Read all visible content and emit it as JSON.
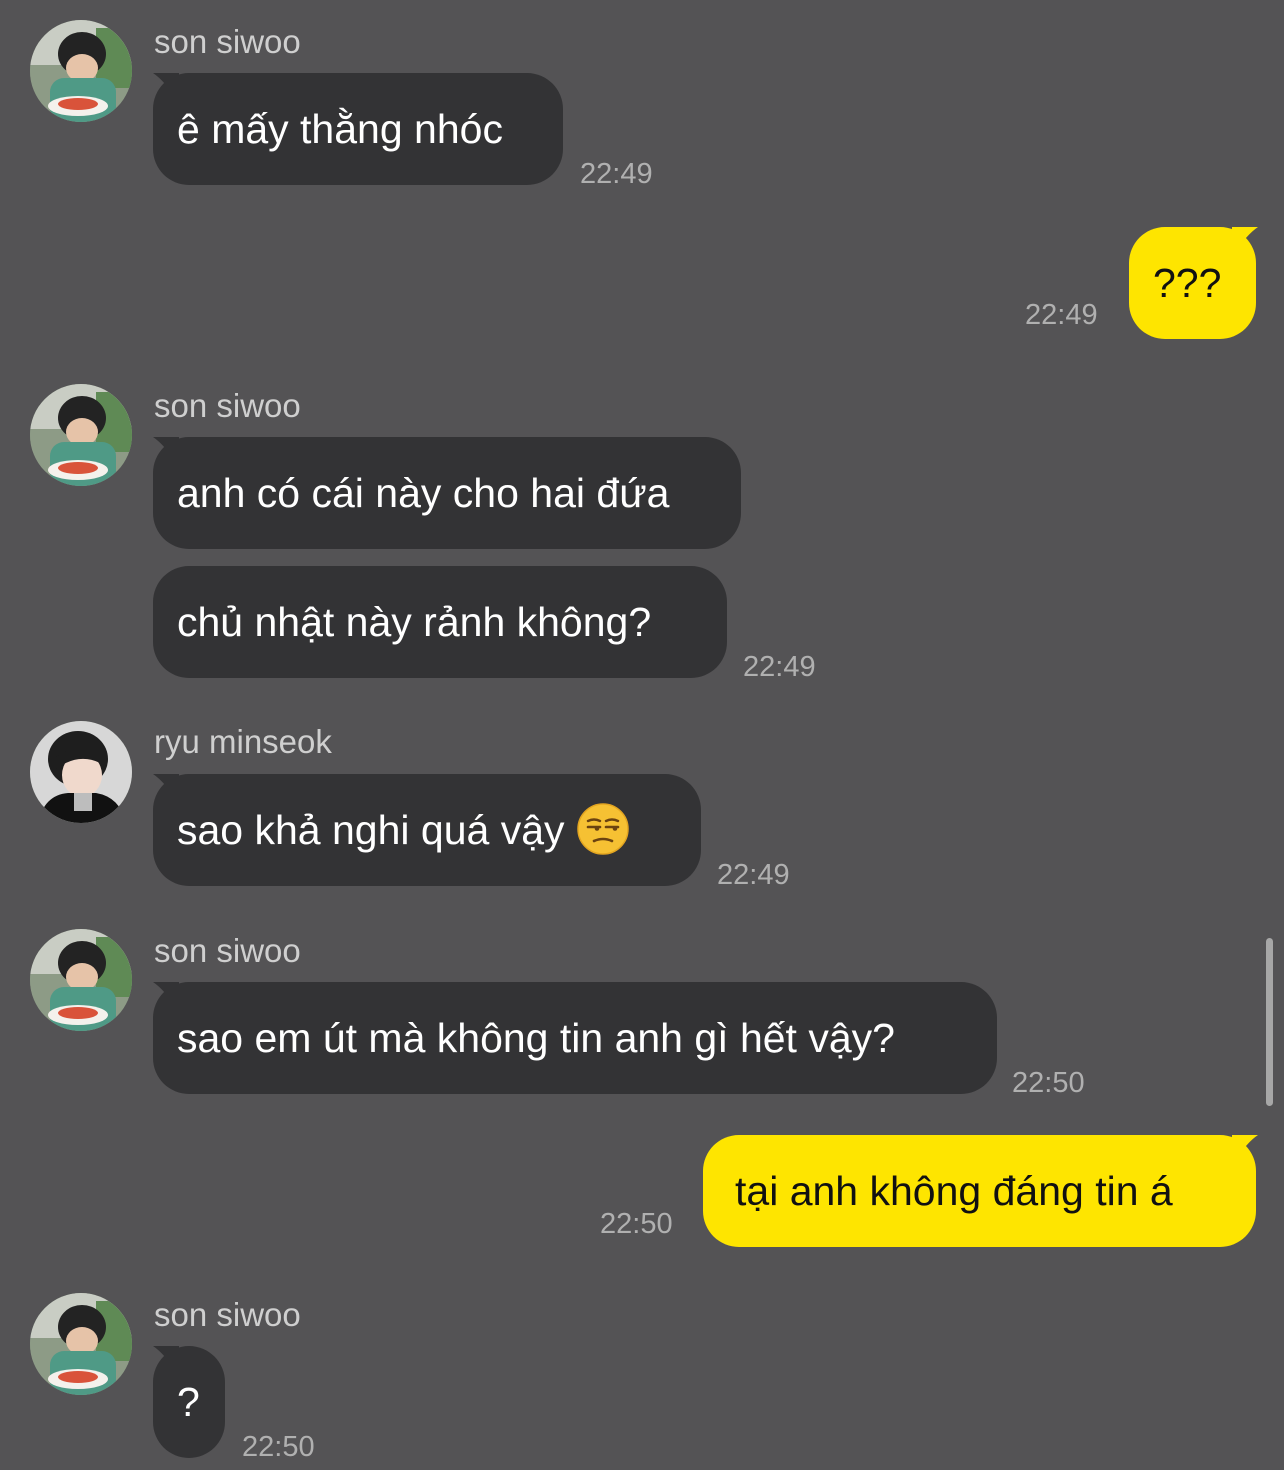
{
  "colors": {
    "background": "#545355",
    "incoming_bubble": "#333335",
    "outgoing_bubble": "#fee500",
    "sender_text": "#cfcfcf",
    "timestamp_text": "#b0b0b0"
  },
  "senders": {
    "son_siwoo": "son siwoo",
    "ryu_minseok": "ryu minseok"
  },
  "messages": [
    {
      "direction": "in",
      "sender": "son siwoo",
      "text": "ê mấy thằng nhóc",
      "time": "22:49"
    },
    {
      "direction": "out",
      "text": "???",
      "time": "22:49"
    },
    {
      "direction": "in",
      "sender": "son siwoo",
      "text": "anh có cái này cho hai đứa"
    },
    {
      "direction": "in",
      "text": "chủ nhật này rảnh không?",
      "time": "22:49"
    },
    {
      "direction": "in",
      "sender": "ryu minseok",
      "text": "sao khả nghi quá vậy",
      "emoji": "unamused-face-icon",
      "time": "22:49"
    },
    {
      "direction": "in",
      "sender": "son siwoo",
      "text": "sao em út mà không tin anh gì hết vậy?",
      "time": "22:50"
    },
    {
      "direction": "out",
      "text": "tại anh không đáng tin á",
      "time": "22:50"
    },
    {
      "direction": "in",
      "sender": "son siwoo",
      "text": "?",
      "time": "22:50"
    }
  ]
}
